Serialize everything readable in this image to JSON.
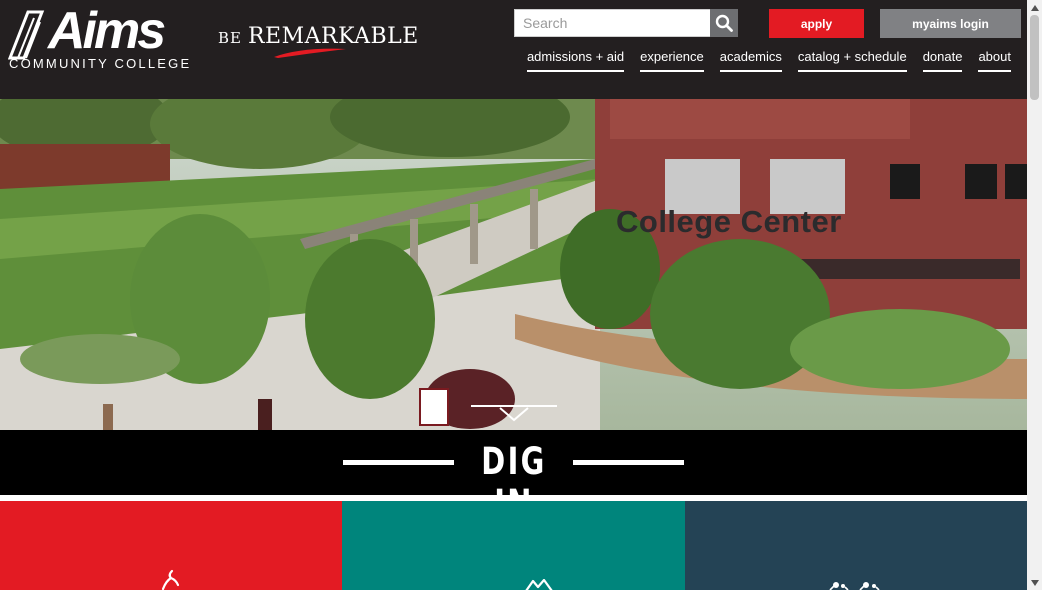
{
  "brand": {
    "logo_word": "Aims",
    "logo_sub": "COMMUNITY COLLEGE",
    "tagline_prefix": "BE",
    "tagline": "REMARKABLE"
  },
  "header": {
    "search_placeholder": "Search",
    "apply_label": "apply",
    "login_label": "myaims login"
  },
  "nav": {
    "items": [
      "admissions + aid",
      "experience",
      "academics",
      "catalog + schedule",
      "donate",
      "about"
    ]
  },
  "hero": {
    "sign_text": "College Center"
  },
  "section": {
    "title": "DIG IN"
  },
  "colors": {
    "header_bg": "#231f20",
    "apply_red": "#e31b23",
    "login_gray": "#808184",
    "card_teal": "#00857c",
    "card_navy": "#244355"
  },
  "icons": [
    "search-icon",
    "scroll-down-arrow-icon",
    "runner-icon",
    "mountain-icon",
    "people-icon"
  ]
}
